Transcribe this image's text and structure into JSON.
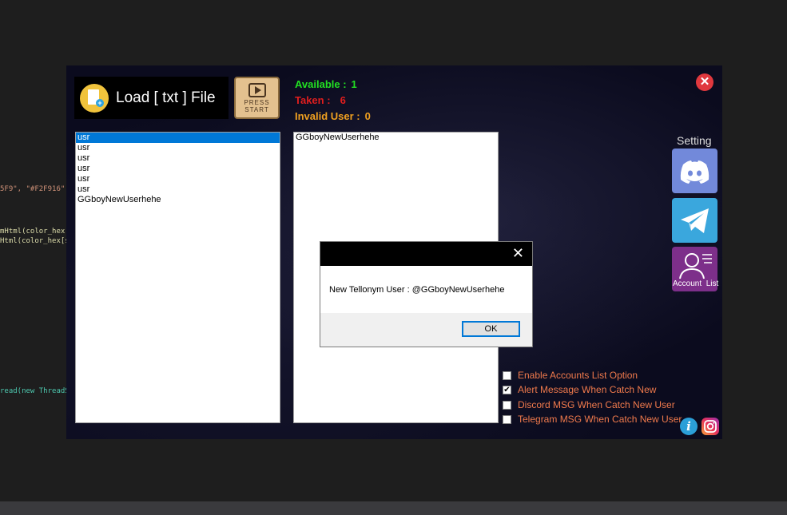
{
  "background_code": [
    {
      "text": "5F9\", \"#F2F916\",",
      "color": "#ce9178"
    },
    {
      "text": "mHtml(color_hex[",
      "color": "#dcdcaa"
    },
    {
      "text": "Html(color_hex[s",
      "color": "#dcdcaa"
    },
    {
      "text": "read(new ThreadS",
      "color": "#4ec9b0"
    }
  ],
  "toolbar": {
    "load_label": "Load [ txt ] File",
    "start_label_1": "PRESS",
    "start_label_2": "START"
  },
  "stats": [
    {
      "label": "Available :",
      "value": "1",
      "color": "#22e022"
    },
    {
      "label": "Taken :",
      "value": "6",
      "color": "#e01e1e"
    },
    {
      "label": "Invalid User :",
      "value": "0",
      "color": "#f0a020"
    }
  ],
  "user_list": [
    "usr",
    "usr",
    "usr",
    "usr",
    "usr",
    "usr",
    "GGboyNewUserhehe"
  ],
  "available_list": [
    "GGboyNewUserhehe"
  ],
  "sidebar": {
    "setting_label": "Setting",
    "account_list_label": "Account  List"
  },
  "options": [
    {
      "label": "Enable Accounts List Option",
      "checked": false
    },
    {
      "label": "Alert Message When Catch New",
      "checked": true
    },
    {
      "label": "Discord MSG When Catch New User",
      "checked": false
    },
    {
      "label": "Telegram MSG When Catch New User",
      "checked": false
    }
  ],
  "dialog": {
    "message": "New Tellonym User : @GGboyNewUserhehe",
    "ok_label": "OK",
    "close_glyph": "✕"
  },
  "icons": {
    "close": "✕",
    "info": "i",
    "checkmark": "✔"
  }
}
